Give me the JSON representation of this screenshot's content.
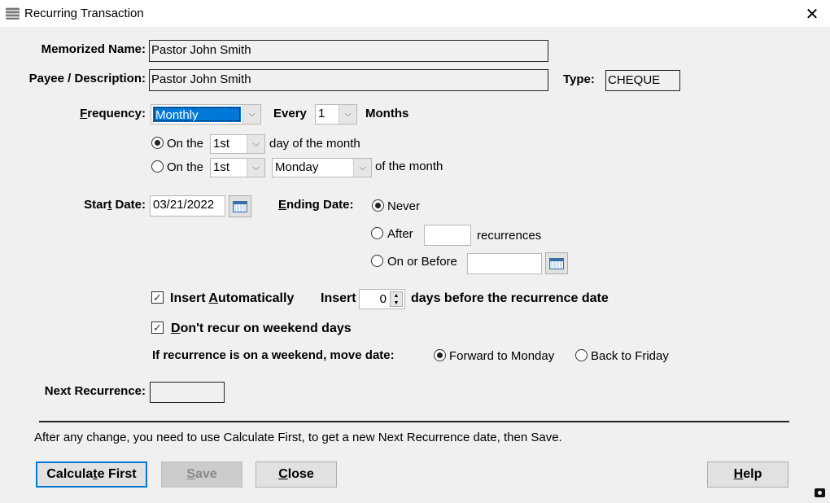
{
  "window": {
    "title": "Recurring Transaction",
    "close_icon": "close-icon"
  },
  "memorized_name": {
    "label": "Memorized Name:",
    "value": "Pastor John Smith"
  },
  "payee": {
    "label": "Payee / Description:",
    "value": "Pastor John Smith"
  },
  "type": {
    "label": "Type:",
    "value": "CHEQUE"
  },
  "frequency": {
    "label_mnemonic": "F",
    "label_rest": "requency:",
    "value": "Monthly",
    "every_label": "Every",
    "every_value": "1",
    "unit_label": "Months"
  },
  "monthly": {
    "option1": {
      "label": "On the",
      "day": "1st",
      "suffix": "day of the month",
      "selected": true
    },
    "option2": {
      "label": "On the",
      "ordinal": "1st",
      "weekday": "Monday",
      "suffix": "of the month",
      "selected": false
    }
  },
  "start_date": {
    "label_a": "Star",
    "label_mnemonic": "t",
    "label_b": " Date:",
    "value": "03/21/2022"
  },
  "ending": {
    "label_mnemonic": "E",
    "label_rest": "nding Date:",
    "never": "Never",
    "after": "After",
    "after_value": "",
    "recurrences": "recurrences",
    "on_or_before": "On or Before",
    "on_or_before_value": "",
    "selected": "Never"
  },
  "insert_auto": {
    "label_a": "Insert ",
    "label_mnemonic": "A",
    "label_b": "utomatically",
    "checked": true,
    "insert_label": "Insert",
    "days_value": "0",
    "days_suffix": "days before the recurrence date"
  },
  "weekend": {
    "label_mnemonic": "D",
    "label_rest": "on't recur on weekend days",
    "checked": true,
    "move_label": "If recurrence is on a weekend, move date:",
    "forward": "Forward to Monday",
    "back": "Back to Friday",
    "selected": "Forward to Monday"
  },
  "next_recurrence": {
    "label": "Next Recurrence:",
    "value": ""
  },
  "note": "After any change, you need to use Calculate First, to get a new Next Recurrence date, then Save.",
  "buttons": {
    "calculate": {
      "a": "Calcula",
      "m": "t",
      "b": "e First"
    },
    "save": {
      "a": "",
      "m": "S",
      "b": "ave",
      "disabled": true
    },
    "close": {
      "a": "",
      "m": "C",
      "b": "lose"
    },
    "help": {
      "a": "",
      "m": "H",
      "b": "elp"
    }
  }
}
